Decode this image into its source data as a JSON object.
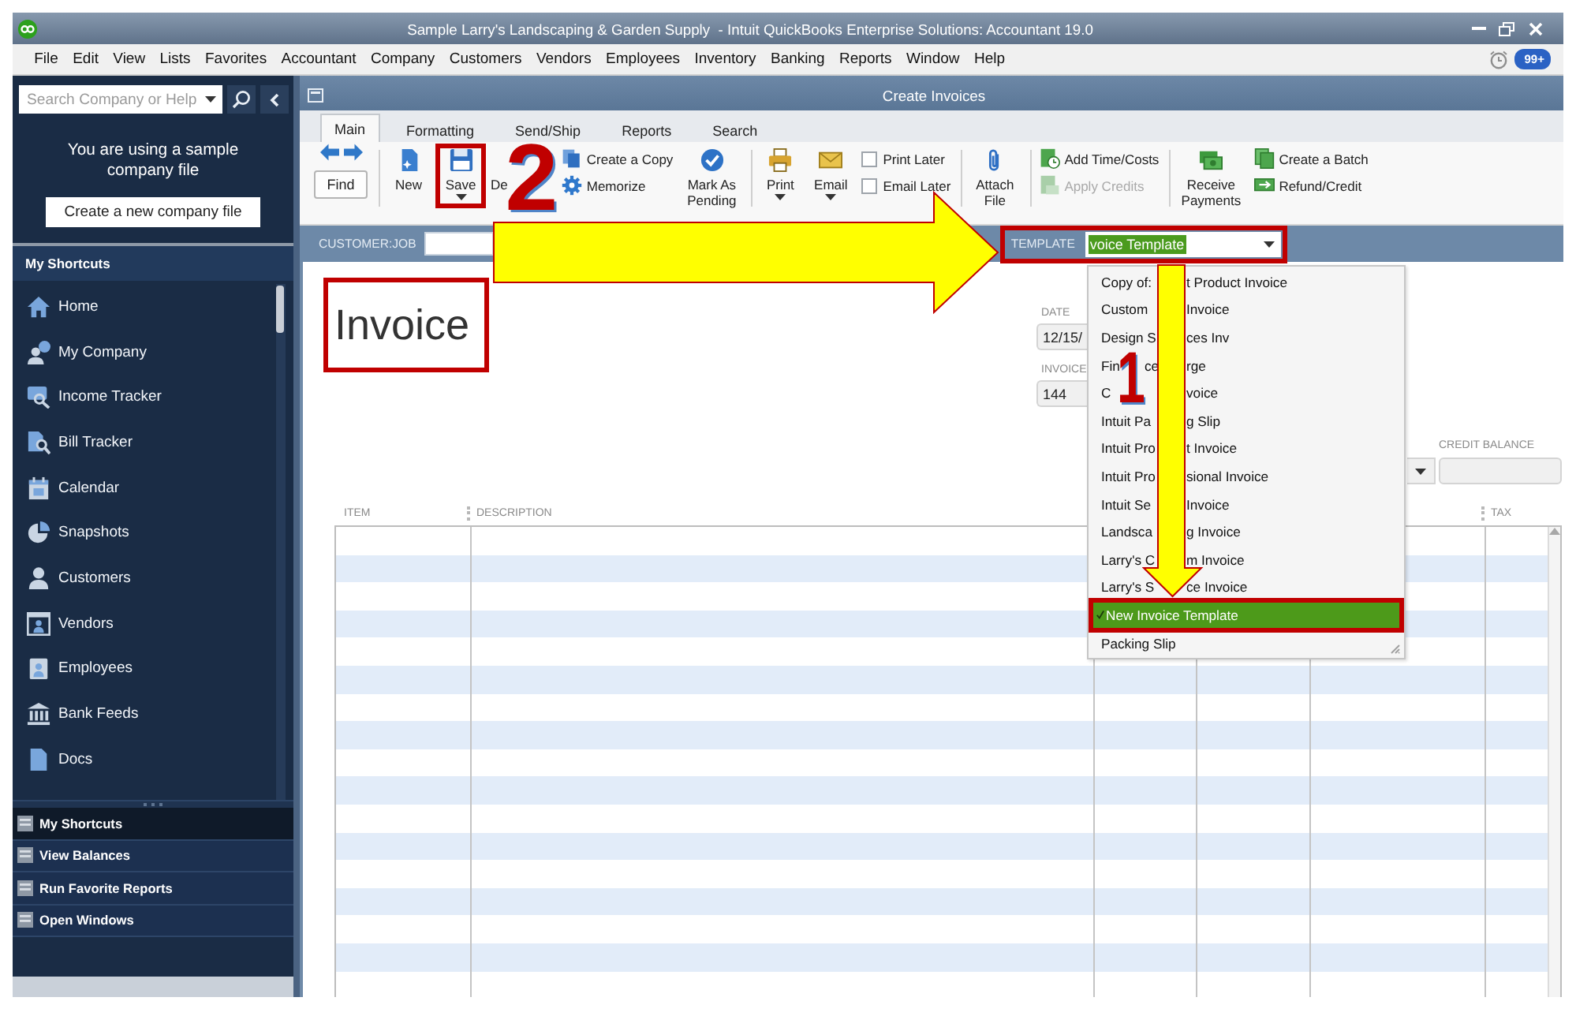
{
  "window": {
    "title": "Sample Larry's Landscaping & Garden Supply  - Intuit QuickBooks Enterprise Solutions: Accountant 19.0"
  },
  "menu": [
    "File",
    "Edit",
    "View",
    "Lists",
    "Favorites",
    "Accountant",
    "Company",
    "Customers",
    "Vendors",
    "Employees",
    "Inventory",
    "Banking",
    "Reports",
    "Window",
    "Help"
  ],
  "notifications": {
    "badge": "99+"
  },
  "sidebar": {
    "search": {
      "placeholder": "Search Company or Help"
    },
    "notice": "You are using a sample company file",
    "create_button": "Create a new company file",
    "shortcuts_title": "My Shortcuts",
    "shortcuts": [
      "Home",
      "My Company",
      "Income Tracker",
      "Bill Tracker",
      "Calendar",
      "Snapshots",
      "Customers",
      "Vendors",
      "Employees",
      "Bank Feeds",
      "Docs"
    ],
    "sections": [
      {
        "label": "My Shortcuts",
        "selected": true
      },
      {
        "label": "View Balances",
        "selected": false
      },
      {
        "label": "Run Favorite Reports",
        "selected": false
      },
      {
        "label": "Open Windows",
        "selected": false
      }
    ]
  },
  "invoice_window": {
    "title": "Create Invoices",
    "tabs": [
      {
        "label": "Main",
        "selected": true
      },
      {
        "label": "Formatting",
        "selected": false
      },
      {
        "label": "Send/Ship",
        "selected": false
      },
      {
        "label": "Reports",
        "selected": false
      },
      {
        "label": "Search",
        "selected": false
      }
    ]
  },
  "toolbar": [
    {
      "items": [
        {
          "kind": "history"
        },
        {
          "kind": "button",
          "label": "Find"
        }
      ]
    },
    {
      "items": [
        {
          "kind": "large",
          "label": "New",
          "menu": false,
          "highlighted": false
        },
        {
          "kind": "large",
          "label": "Save",
          "menu": true,
          "highlighted": true
        },
        {
          "kind": "large",
          "label": "De",
          "menu": false,
          "highlighted": false
        },
        {
          "kind": "stack",
          "items": [
            {
              "label": "Create a Copy",
              "disabled": false
            },
            {
              "label": "Memorize",
              "disabled": false
            }
          ]
        },
        {
          "kind": "large",
          "label": "Mark As Pending",
          "menu": false,
          "highlighted": false
        }
      ]
    },
    {
      "items": [
        {
          "kind": "large",
          "label": "Print",
          "menu": true,
          "highlighted": false
        },
        {
          "kind": "large",
          "label": "Email",
          "menu": true,
          "highlighted": false
        },
        {
          "kind": "checks",
          "items": [
            {
              "label": "Print Later",
              "checked": false
            },
            {
              "label": "Email Later",
              "checked": false
            }
          ]
        }
      ]
    },
    {
      "items": [
        {
          "kind": "large",
          "label": "Attach File",
          "menu": false,
          "highlighted": false
        }
      ]
    },
    {
      "items": [
        {
          "kind": "stack",
          "items": [
            {
              "label": "Add Time/Costs",
              "disabled": false
            },
            {
              "label": "Apply Credits",
              "disabled": true
            }
          ]
        }
      ]
    },
    {
      "items": [
        {
          "kind": "large",
          "label": "Receive Payments",
          "menu": false,
          "highlighted": false
        },
        {
          "kind": "stack",
          "items": [
            {
              "label": "Create a Batch",
              "disabled": false
            },
            {
              "label": "Refund/Credit",
              "disabled": false
            }
          ]
        }
      ]
    }
  ],
  "customer_job": {
    "label": "CUSTOMER:JOB"
  },
  "template": {
    "label": "TEMPLATE",
    "value": "voice Template",
    "value_selected": true,
    "highlighted": true,
    "options": [
      {
        "segments": [
          "Copy of:",
          "t Product Invoice"
        ],
        "selected": false,
        "checked": false,
        "highlighted": false
      },
      {
        "segments": [
          "Custom",
          "Invoice"
        ],
        "selected": false,
        "checked": false,
        "highlighted": false
      },
      {
        "segments": [
          "Design S",
          "ces Inv"
        ],
        "selected": false,
        "checked": false,
        "highlighted": false
      },
      {
        "segments": [
          "Fin",
          "ce",
          "rge"
        ],
        "selected": false,
        "checked": false,
        "highlighted": false
      },
      {
        "segments": [
          "C",
          "voice"
        ],
        "selected": false,
        "checked": false,
        "highlighted": false
      },
      {
        "segments": [
          "Intuit Pa",
          "g Slip"
        ],
        "selected": false,
        "checked": false,
        "highlighted": false
      },
      {
        "segments": [
          "Intuit Pro",
          "t Invoice"
        ],
        "selected": false,
        "checked": false,
        "highlighted": false
      },
      {
        "segments": [
          "Intuit Pro",
          "sional Invoice"
        ],
        "selected": false,
        "checked": false,
        "highlighted": false
      },
      {
        "segments": [
          "Intuit Se",
          "Invoice"
        ],
        "selected": false,
        "checked": false,
        "highlighted": false
      },
      {
        "segments": [
          "Landsca",
          "g Invoice"
        ],
        "selected": false,
        "checked": false,
        "highlighted": false
      },
      {
        "segments": [
          "Larry's C",
          "m Invoice"
        ],
        "selected": false,
        "checked": false,
        "highlighted": false
      },
      {
        "segments": [
          "Larry's S",
          "ce Invoice"
        ],
        "selected": false,
        "checked": false,
        "highlighted": false
      },
      {
        "segments": [
          "New Invoice Template"
        ],
        "selected": true,
        "checked": true,
        "highlighted": true
      },
      {
        "segments": [
          "Packing Slip"
        ],
        "selected": false,
        "checked": false,
        "highlighted": false
      }
    ]
  },
  "invoice_title": {
    "text": "Invoice",
    "highlighted": true
  },
  "date": {
    "label": "DATE",
    "value": "12/15/"
  },
  "invoice_number": {
    "label": "INVOICE",
    "value": "144"
  },
  "credit_balance": {
    "label": "CREDIT BALANCE"
  },
  "table": {
    "columns": [
      "ITEM",
      "DESCRIPTION",
      "TAX"
    ]
  },
  "annotations": {
    "steps": [
      "2",
      "1"
    ],
    "arrows": [
      {
        "kind": "right"
      },
      {
        "kind": "down"
      }
    ]
  }
}
